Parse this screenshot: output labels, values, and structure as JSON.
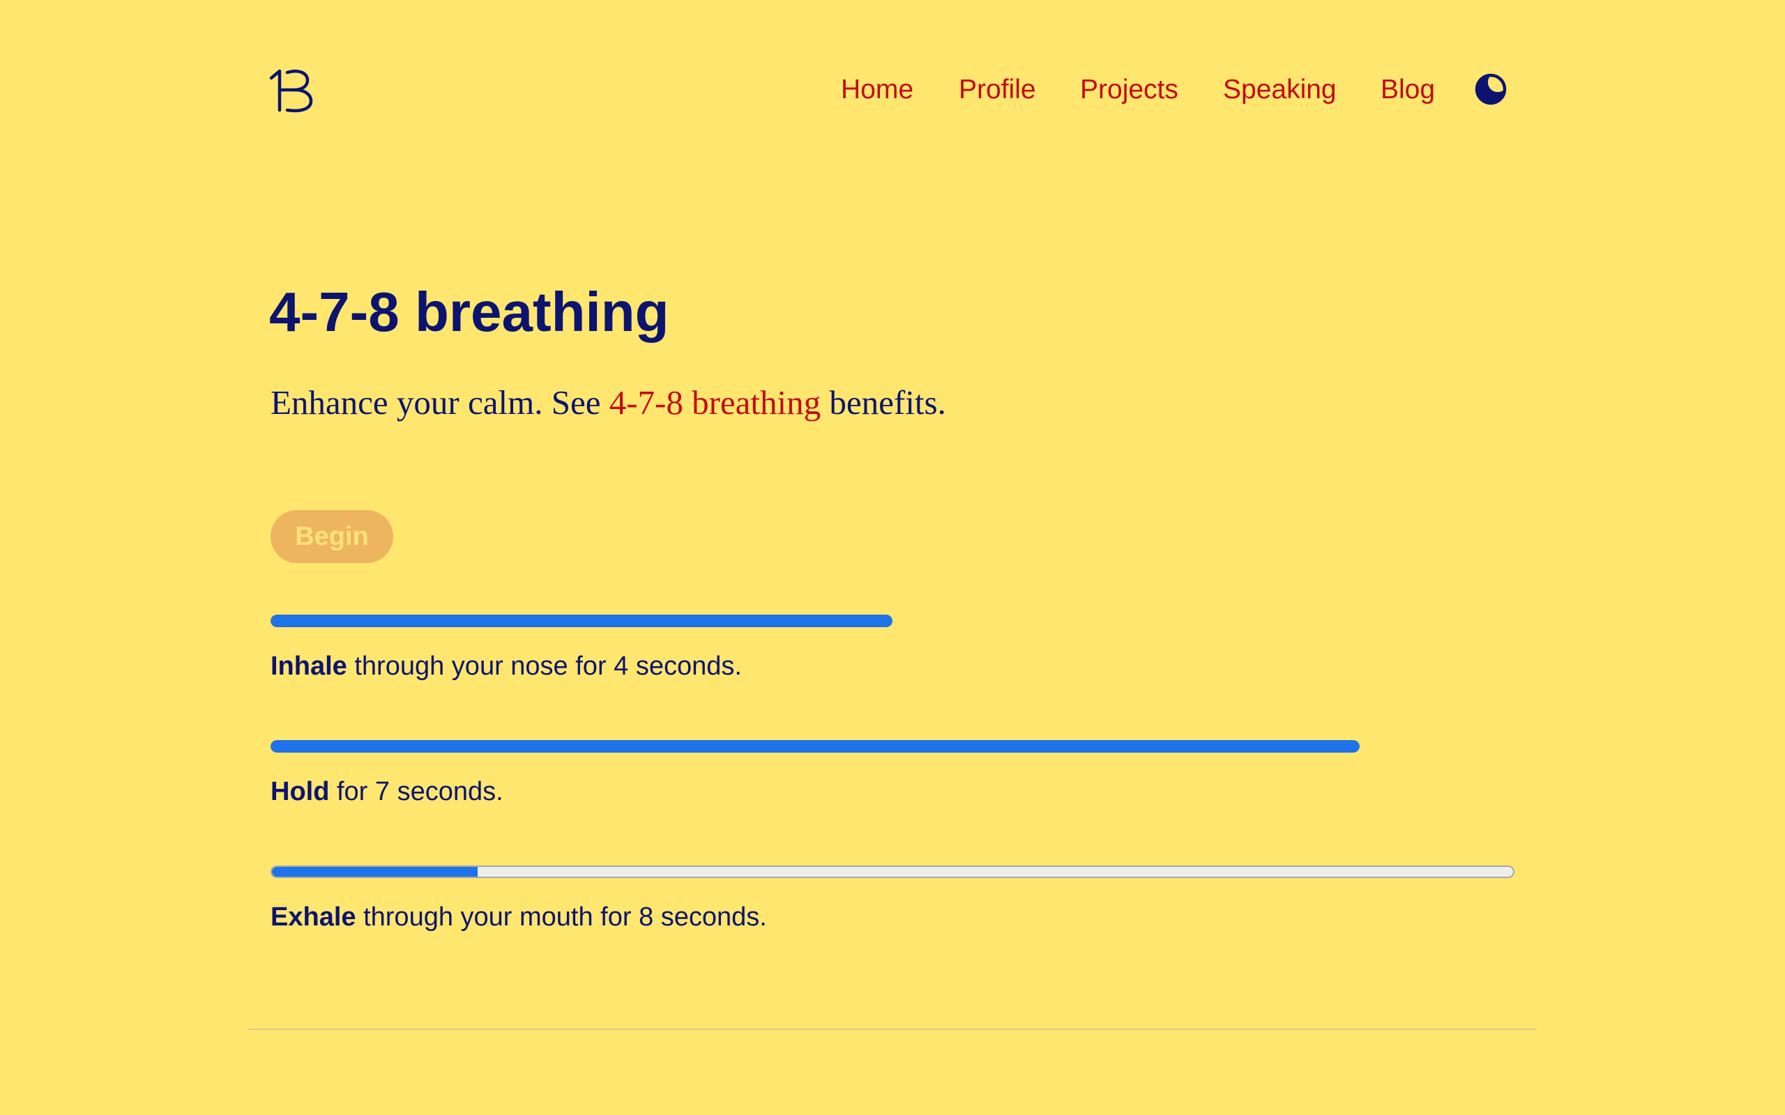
{
  "nav": {
    "links": [
      "Home",
      "Profile",
      "Projects",
      "Speaking",
      "Blog"
    ]
  },
  "icons": {
    "logo": "brand-logo-icon",
    "theme_toggle": "moon-icon"
  },
  "colors": {
    "background": "#ffe66f",
    "text": "#0c1470",
    "link": "#c10d14",
    "progress": "#1f73e8",
    "button_bg": "#edb55e",
    "button_text": "#ffe27a"
  },
  "page": {
    "title": "4-7-8 breathing",
    "intro_prefix": "Enhance your calm. See ",
    "intro_link": "4-7-8 breathing",
    "intro_suffix": " benefits."
  },
  "begin_label": "Begin",
  "steps": [
    {
      "label": "Inhale",
      "text": " through your nose for 4 seconds.",
      "progress_percent": 100
    },
    {
      "label": "Hold",
      "text": " for 7 seconds.",
      "progress_percent": 100
    },
    {
      "label": "Exhale",
      "text": " through your mouth for 8 seconds.",
      "progress_percent": 16.6
    }
  ]
}
